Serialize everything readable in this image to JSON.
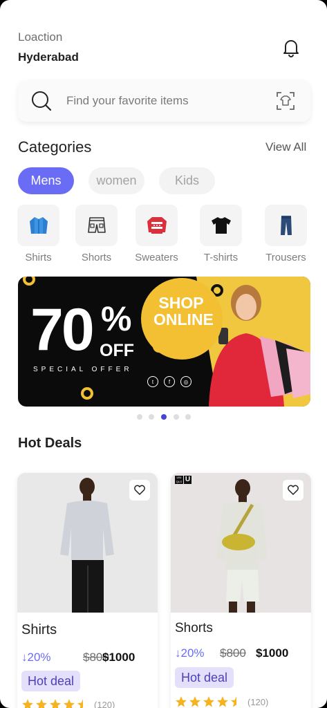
{
  "header": {
    "location_label": "Loaction",
    "location_value": "Hyderabad",
    "bell_icon": "bell-icon"
  },
  "search": {
    "placeholder": "Find your favorite items",
    "search_icon": "search-icon",
    "scan_icon": "scan-icon"
  },
  "categories": {
    "title": "Categories",
    "view_all": "View All",
    "filters": [
      {
        "label": "Mens",
        "active": true
      },
      {
        "label": "women",
        "active": false
      },
      {
        "label": "Kids",
        "active": false
      }
    ],
    "items": [
      {
        "label": "Shirts",
        "icon": "jacket-icon"
      },
      {
        "label": "Shorts",
        "icon": "shorts-icon"
      },
      {
        "label": "Sweaters",
        "icon": "sweater-icon"
      },
      {
        "label": "T-shirts",
        "icon": "tshirt-icon"
      },
      {
        "label": "Trousers",
        "icon": "trousers-icon"
      }
    ]
  },
  "banner": {
    "percent": "70",
    "percent_sign": "%",
    "off": "OFF",
    "subtitle": "SPECIAL OFFER",
    "shop_line1": "SHOP",
    "shop_line2": "ONLINE",
    "page_count": 5,
    "active_page": 3
  },
  "hot_deals": {
    "title": "Hot Deals",
    "products": [
      {
        "name": "Shirts",
        "discount": "20%",
        "old_price": "$800",
        "price": "$1000",
        "badge": "Hot deal",
        "reviews": "(120)",
        "rating": 4.5
      },
      {
        "name": "Shorts",
        "discount": "20%",
        "old_price": "$800",
        "price": "$1000",
        "badge": "Hot deal",
        "reviews": "(120)",
        "rating": 4.5,
        "brand_mark": "UNI QLO"
      }
    ]
  },
  "colors": {
    "accent": "#6b6cf6",
    "badge_bg": "#e4e0fb",
    "banner_yellow": "#f2c032",
    "star": "#f5b321"
  }
}
